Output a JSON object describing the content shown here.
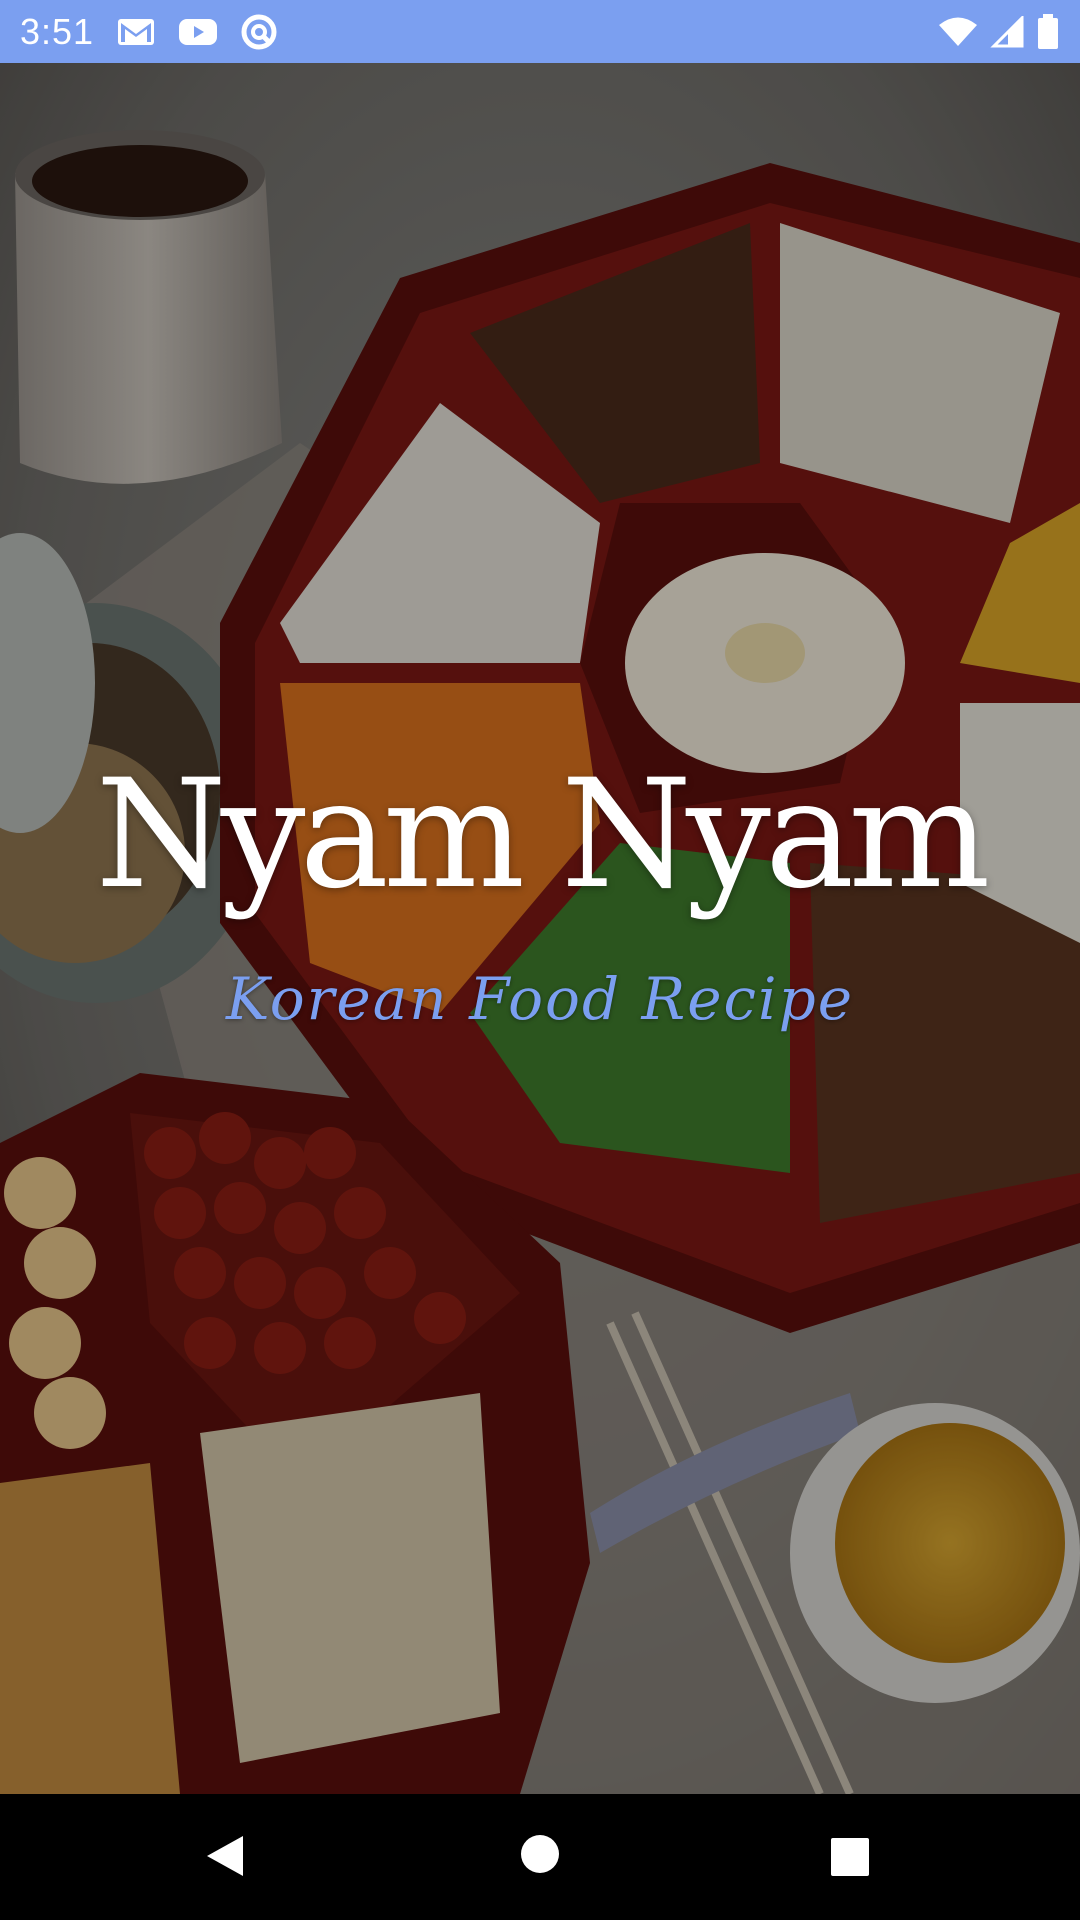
{
  "status_bar": {
    "time": "3:51",
    "notification_icons": [
      "gmail-icon",
      "youtube-icon",
      "sync-icon"
    ],
    "system_icons": [
      "wifi-icon",
      "cell-signal-icon",
      "battery-icon"
    ],
    "background_color": "#7b9ff0"
  },
  "splash": {
    "title": "Nyam Nyam",
    "subtitle": "Korean Food Recipe",
    "title_color": "#ffffff",
    "subtitle_color": "#7b9ff0"
  },
  "nav_bar": {
    "buttons": [
      "back-icon",
      "home-icon",
      "recents-icon"
    ]
  }
}
